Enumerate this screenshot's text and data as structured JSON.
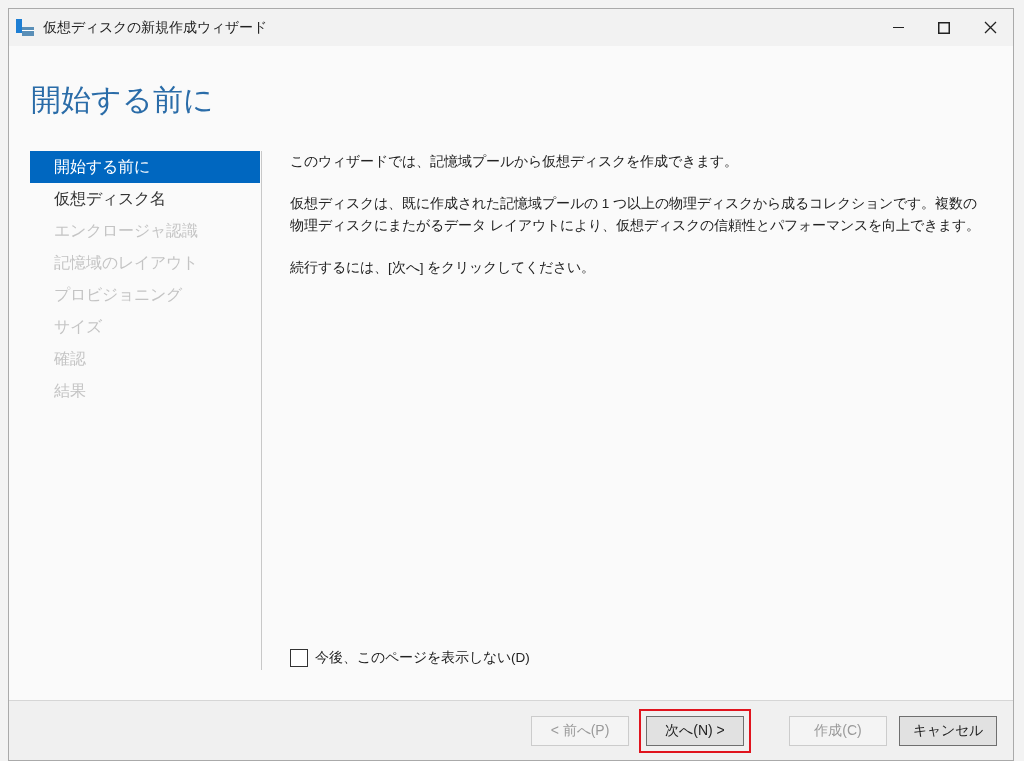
{
  "window": {
    "title": "仮想ディスクの新規作成ウィザード"
  },
  "page_title": "開始する前に",
  "steps": [
    {
      "label": "開始する前に",
      "selected": true,
      "disabled": false
    },
    {
      "label": "仮想ディスク名",
      "selected": false,
      "disabled": false
    },
    {
      "label": "エンクロージャ認識",
      "selected": false,
      "disabled": true
    },
    {
      "label": "記憶域のレイアウト",
      "selected": false,
      "disabled": true
    },
    {
      "label": "プロビジョニング",
      "selected": false,
      "disabled": true
    },
    {
      "label": "サイズ",
      "selected": false,
      "disabled": true
    },
    {
      "label": "確認",
      "selected": false,
      "disabled": true
    },
    {
      "label": "結果",
      "selected": false,
      "disabled": true
    }
  ],
  "paragraphs": [
    "このウィザードでは、記憶域プールから仮想ディスクを作成できます。",
    "仮想ディスクは、既に作成された記憶域プールの 1 つ以上の物理ディスクから成るコレクションです。複数の物理ディスクにまたがるデータ レイアウトにより、仮想ディスクの信頼性とパフォーマンスを向上できます。",
    "続行するには、[次へ] をクリックしてください。"
  ],
  "dont_show_again": {
    "label": "今後、このページを表示しない(D)",
    "checked": false
  },
  "buttons": [
    {
      "label": "< 前へ(P)",
      "disabled": true,
      "highlighted": false
    },
    {
      "label": "次へ(N) >",
      "disabled": false,
      "highlighted": true
    },
    {
      "label": "作成(C)",
      "disabled": true,
      "highlighted": false
    },
    {
      "label": "キャンセル",
      "disabled": false,
      "highlighted": false
    }
  ]
}
